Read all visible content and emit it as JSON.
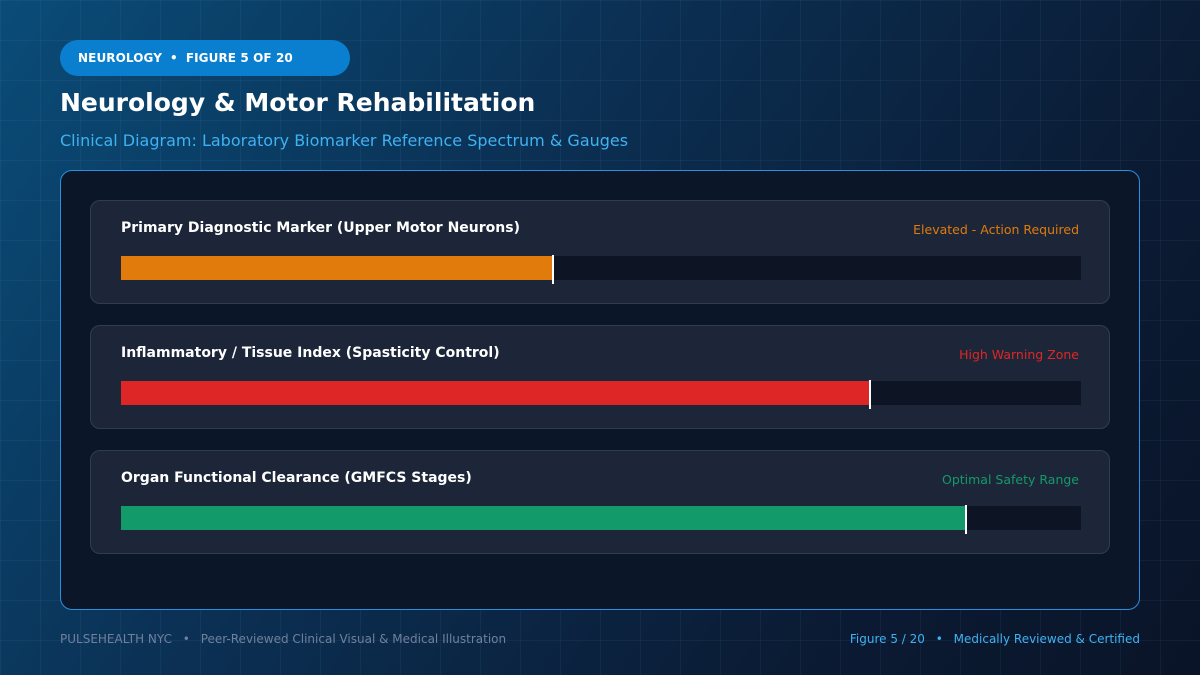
{
  "header": {
    "category": "NEUROLOGY",
    "figure_label": "FIGURE 5 OF 20",
    "title": "Neurology & Motor Rehabilitation",
    "subtitle": "Clinical Diagram: Laboratory Biomarker Reference Spectrum & Gauges"
  },
  "gauges": [
    {
      "label": "Primary Diagnostic Marker (Upper Motor Neurons)",
      "status": "Elevated - Action Required",
      "level": 0.45,
      "color": "#e07b0c"
    },
    {
      "label": "Inflammatory / Tissue Index (Spasticity Control)",
      "status": "High Warning Zone",
      "level": 0.78,
      "color": "#df2626"
    },
    {
      "label": "Organ Functional Clearance (GMFCS Stages)",
      "status": "Optimal Safety Range",
      "level": 0.88,
      "color": "#139a6a"
    }
  ],
  "colors": {
    "accent": "#0b7fcf",
    "subtitle": "#3fb2f2",
    "panel_border": "#2a8fe0"
  },
  "footer": {
    "brand": "PULSEHEALTH NYC",
    "tagline": "Peer-Reviewed Clinical Visual & Medical Illustration",
    "figure": "Figure 5 / 20",
    "certification": "Medically Reviewed & Certified"
  }
}
